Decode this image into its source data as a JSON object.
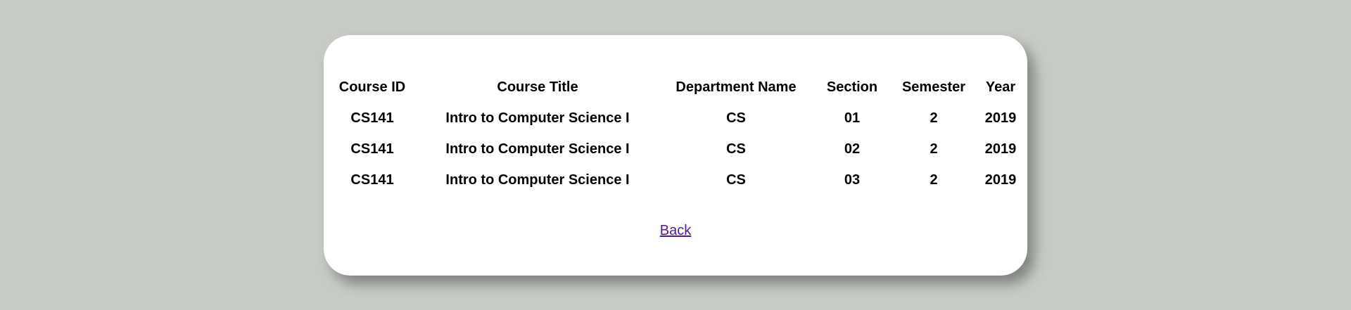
{
  "table": {
    "headers": [
      "Course ID",
      "Course Title",
      "Department Name",
      "Section",
      "Semester",
      "Year"
    ],
    "rows": [
      [
        "CS141",
        "Intro to Computer Science I",
        "CS",
        "01",
        "2",
        "2019"
      ],
      [
        "CS141",
        "Intro to Computer Science I",
        "CS",
        "02",
        "2",
        "2019"
      ],
      [
        "CS141",
        "Intro to Computer Science I",
        "CS",
        "03",
        "2",
        "2019"
      ]
    ]
  },
  "back_link": {
    "label": "Back"
  },
  "colors": {
    "page_background": "#c6cbc4",
    "card_background": "#ffffff",
    "visited_link": "#551a8b"
  }
}
